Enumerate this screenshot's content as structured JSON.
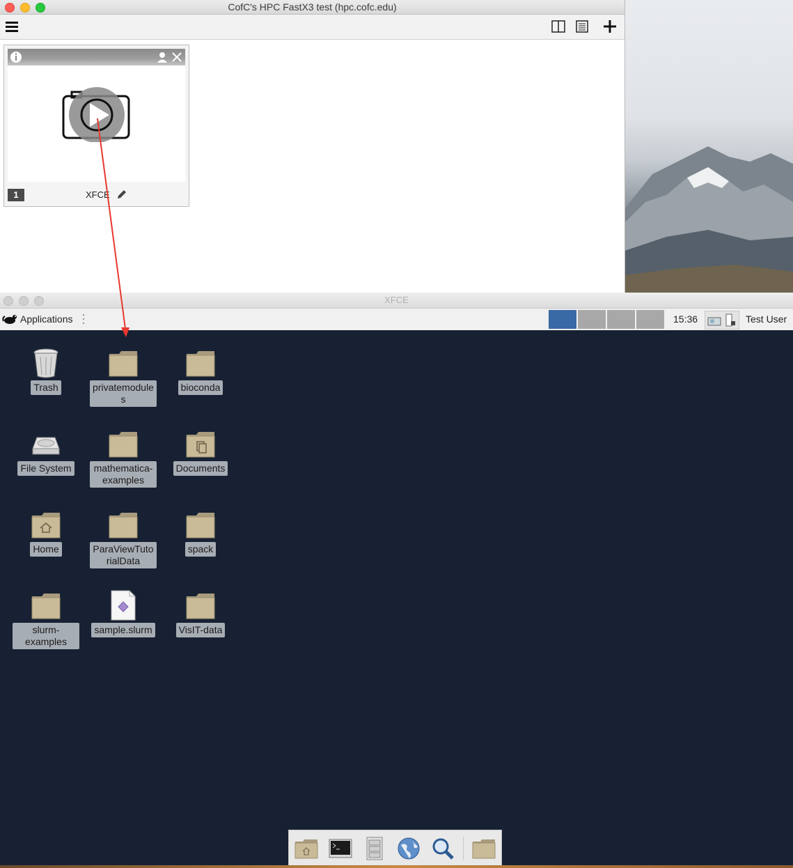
{
  "fastx": {
    "window_title": "CofC's HPC FastX3 test (hpc.cofc.edu)",
    "session": {
      "number": "1",
      "name": "XFCE"
    }
  },
  "xfce": {
    "window_title": "XFCE",
    "panel": {
      "applications_label": "Applications",
      "clock": "15:36",
      "user": "Test User",
      "workspace_count": 4,
      "active_workspace": 1
    },
    "desktop_icons": [
      {
        "label": "Trash",
        "icon": "trash-icon"
      },
      {
        "label": "privatemodules",
        "icon": "folder-icon"
      },
      {
        "label": "bioconda",
        "icon": "folder-icon"
      },
      {
        "label": "File System",
        "icon": "drive-icon"
      },
      {
        "label": "mathematica-examples",
        "icon": "folder-icon"
      },
      {
        "label": "Documents",
        "icon": "documents-folder-icon"
      },
      {
        "label": "Home",
        "icon": "home-folder-icon"
      },
      {
        "label": "ParaViewTutorialData",
        "icon": "folder-icon"
      },
      {
        "label": "spack",
        "icon": "folder-icon"
      },
      {
        "label": "slurm-examples",
        "icon": "folder-icon"
      },
      {
        "label": "sample.slurm",
        "icon": "file-icon"
      },
      {
        "label": "VisIT-data",
        "icon": "folder-icon"
      }
    ],
    "dock": [
      "home-folder-icon",
      "terminal-icon",
      "file-manager-icon",
      "web-browser-icon",
      "search-icon",
      "folder-icon"
    ]
  },
  "colors": {
    "desktop_bg": "#172133",
    "label_bg": "#a7adb4",
    "arrow": "#e8382f",
    "active_workspace": "#3a6aa5"
  }
}
